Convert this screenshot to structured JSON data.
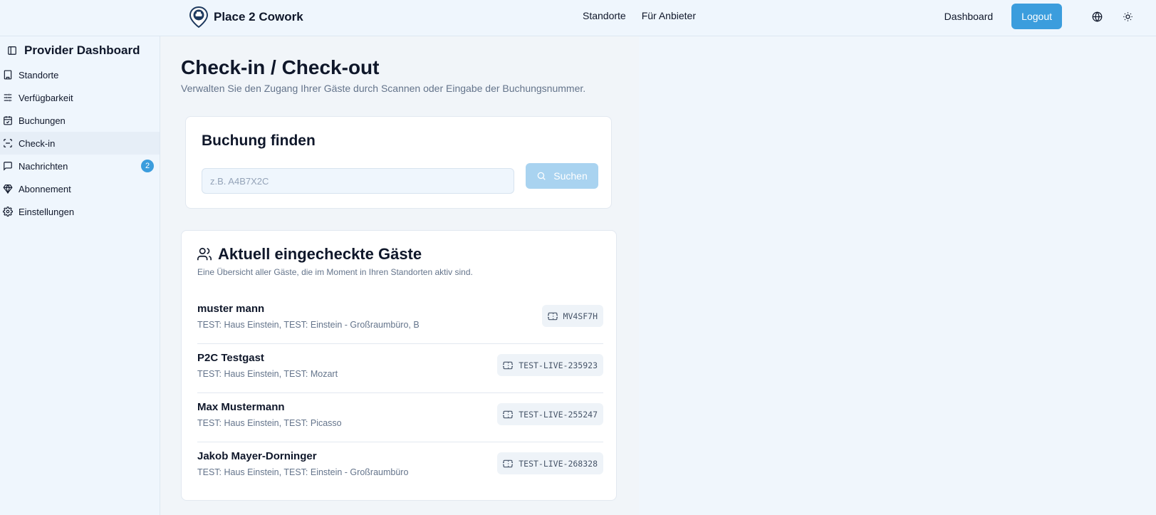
{
  "header": {
    "brand": "Place 2 Cowork",
    "nav": [
      "Standorte",
      "Für Anbieter"
    ],
    "dashboard_link": "Dashboard",
    "logout_label": "Logout"
  },
  "sidebar": {
    "title": "Provider Dashboard",
    "items": [
      {
        "label": "Standorte",
        "icon": "building-icon"
      },
      {
        "label": "Verfügbarkeit",
        "icon": "sliders-icon"
      },
      {
        "label": "Buchungen",
        "icon": "calendar-check-icon"
      },
      {
        "label": "Check-in",
        "icon": "scan-icon"
      },
      {
        "label": "Nachrichten",
        "icon": "message-icon",
        "badge": "2"
      },
      {
        "label": "Abonnement",
        "icon": "gem-icon"
      },
      {
        "label": "Einstellungen",
        "icon": "gear-icon"
      }
    ],
    "active_item": "Check-in"
  },
  "main": {
    "title": "Check-in / Check-out",
    "subtitle": "Verwalten Sie den Zugang Ihrer Gäste durch Scannen oder Eingabe der Buchungsnummer.",
    "search": {
      "title": "Buchung finden",
      "placeholder": "z.B. A4B7X2C",
      "value": "",
      "button_label": "Suchen"
    },
    "guests": {
      "title": "Aktuell eingecheckte Gäste",
      "description": "Eine Übersicht aller Gäste, die im Moment in Ihren Standorten aktiv sind.",
      "rows": [
        {
          "name": "muster mann",
          "location": "TEST: Haus Einstein, TEST: Einstein - Großraumbüro, B",
          "code": "MV4SF7H"
        },
        {
          "name": "P2C Testgast",
          "location": "TEST: Haus Einstein, TEST: Mozart",
          "code": "TEST-LIVE-235923"
        },
        {
          "name": "Max Mustermann",
          "location": "TEST: Haus Einstein, TEST: Picasso",
          "code": "TEST-LIVE-255247"
        },
        {
          "name": "Jakob Mayer-Dorninger",
          "location": "TEST: Haus Einstein, TEST: Einstein - Großraumbüro",
          "code": "TEST-LIVE-268328"
        }
      ]
    }
  },
  "colors": {
    "accent": "#3b9ddd",
    "accent_disabled": "#a9d3f0",
    "muted_text": "#64748b"
  }
}
